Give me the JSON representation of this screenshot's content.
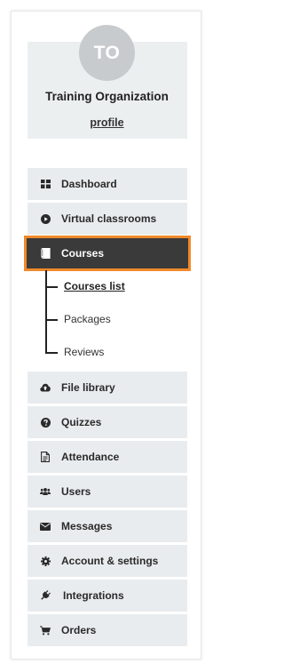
{
  "profile": {
    "initials": "TO",
    "org_name": "Training Organization",
    "link_label": "profile"
  },
  "nav": {
    "dashboard": "Dashboard",
    "virtual_classrooms": "Virtual classrooms",
    "courses": "Courses",
    "courses_sub": {
      "courses_list": "Courses list",
      "packages": "Packages",
      "reviews": "Reviews"
    },
    "file_library": "File library",
    "quizzes": "Quizzes",
    "attendance": "Attendance",
    "users": "Users",
    "messages": "Messages",
    "account_settings": "Account & settings",
    "integrations": "Integrations",
    "orders": "Orders"
  },
  "colors": {
    "active_bg": "#3a3a3a",
    "active_outline": "#f0892a",
    "item_bg": "#e9ecee",
    "avatar_bg": "#c8cbcd"
  }
}
